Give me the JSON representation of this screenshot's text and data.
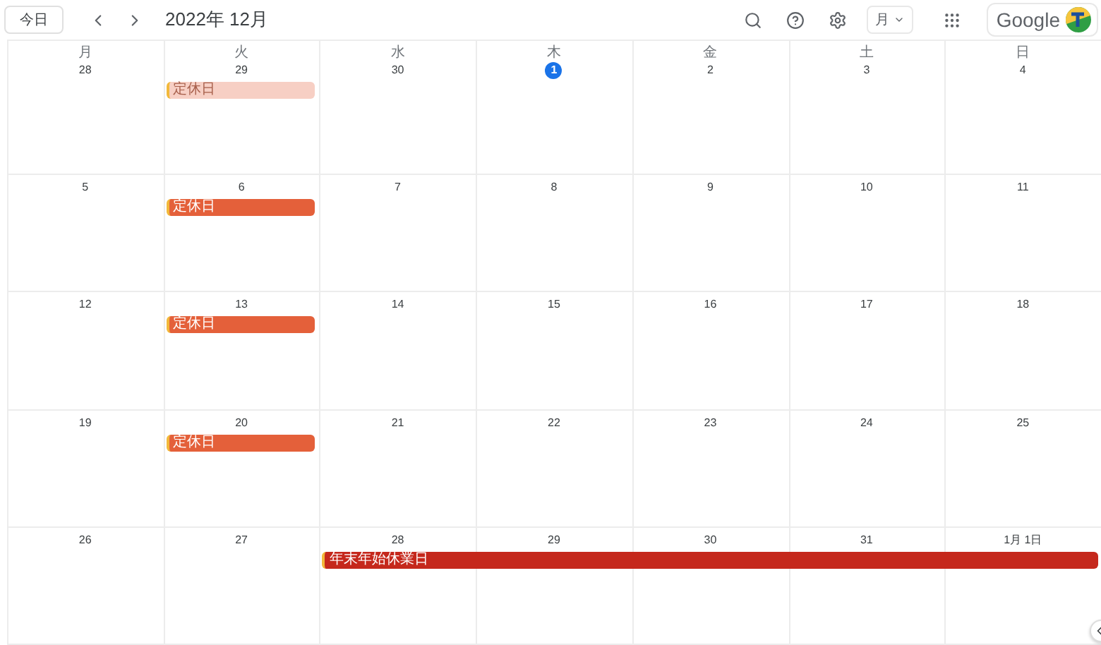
{
  "toolbar": {
    "today_button": "今日",
    "title": "2022年 12月",
    "view_select": "月",
    "account_label": "Google"
  },
  "weekdays": [
    "月",
    "火",
    "水",
    "木",
    "金",
    "土",
    "日"
  ],
  "weeks": [
    {
      "days": [
        {
          "label": "28",
          "today": false
        },
        {
          "label": "29",
          "today": false,
          "events": [
            {
              "title": "定休日",
              "kind": "closed",
              "past": true,
              "to_week_end": false
            }
          ]
        },
        {
          "label": "30",
          "today": false
        },
        {
          "label": "1",
          "today": true
        },
        {
          "label": "2",
          "today": false
        },
        {
          "label": "3",
          "today": false
        },
        {
          "label": "4",
          "today": false
        }
      ]
    },
    {
      "days": [
        {
          "label": "5",
          "today": false
        },
        {
          "label": "6",
          "today": false,
          "events": [
            {
              "title": "定休日",
              "kind": "closed",
              "past": false,
              "to_week_end": false
            }
          ]
        },
        {
          "label": "7",
          "today": false
        },
        {
          "label": "8",
          "today": false
        },
        {
          "label": "9",
          "today": false
        },
        {
          "label": "10",
          "today": false
        },
        {
          "label": "11",
          "today": false
        }
      ]
    },
    {
      "days": [
        {
          "label": "12",
          "today": false
        },
        {
          "label": "13",
          "today": false,
          "events": [
            {
              "title": "定休日",
              "kind": "closed",
              "past": false,
              "to_week_end": false
            }
          ]
        },
        {
          "label": "14",
          "today": false
        },
        {
          "label": "15",
          "today": false
        },
        {
          "label": "16",
          "today": false
        },
        {
          "label": "17",
          "today": false
        },
        {
          "label": "18",
          "today": false
        }
      ]
    },
    {
      "days": [
        {
          "label": "19",
          "today": false
        },
        {
          "label": "20",
          "today": false,
          "events": [
            {
              "title": "定休日",
              "kind": "closed",
              "past": false,
              "to_week_end": false
            }
          ]
        },
        {
          "label": "21",
          "today": false
        },
        {
          "label": "22",
          "today": false
        },
        {
          "label": "23",
          "today": false
        },
        {
          "label": "24",
          "today": false
        },
        {
          "label": "25",
          "today": false
        }
      ]
    },
    {
      "days": [
        {
          "label": "26",
          "today": false
        },
        {
          "label": "27",
          "today": false
        },
        {
          "label": "28",
          "today": false,
          "events": [
            {
              "title": "年末年始休業日",
              "kind": "holiday",
              "past": false,
              "to_week_end": true
            }
          ]
        },
        {
          "label": "29",
          "today": false
        },
        {
          "label": "30",
          "today": false
        },
        {
          "label": "31",
          "today": false
        },
        {
          "label": "1月 1日",
          "today": false
        }
      ]
    }
  ]
}
